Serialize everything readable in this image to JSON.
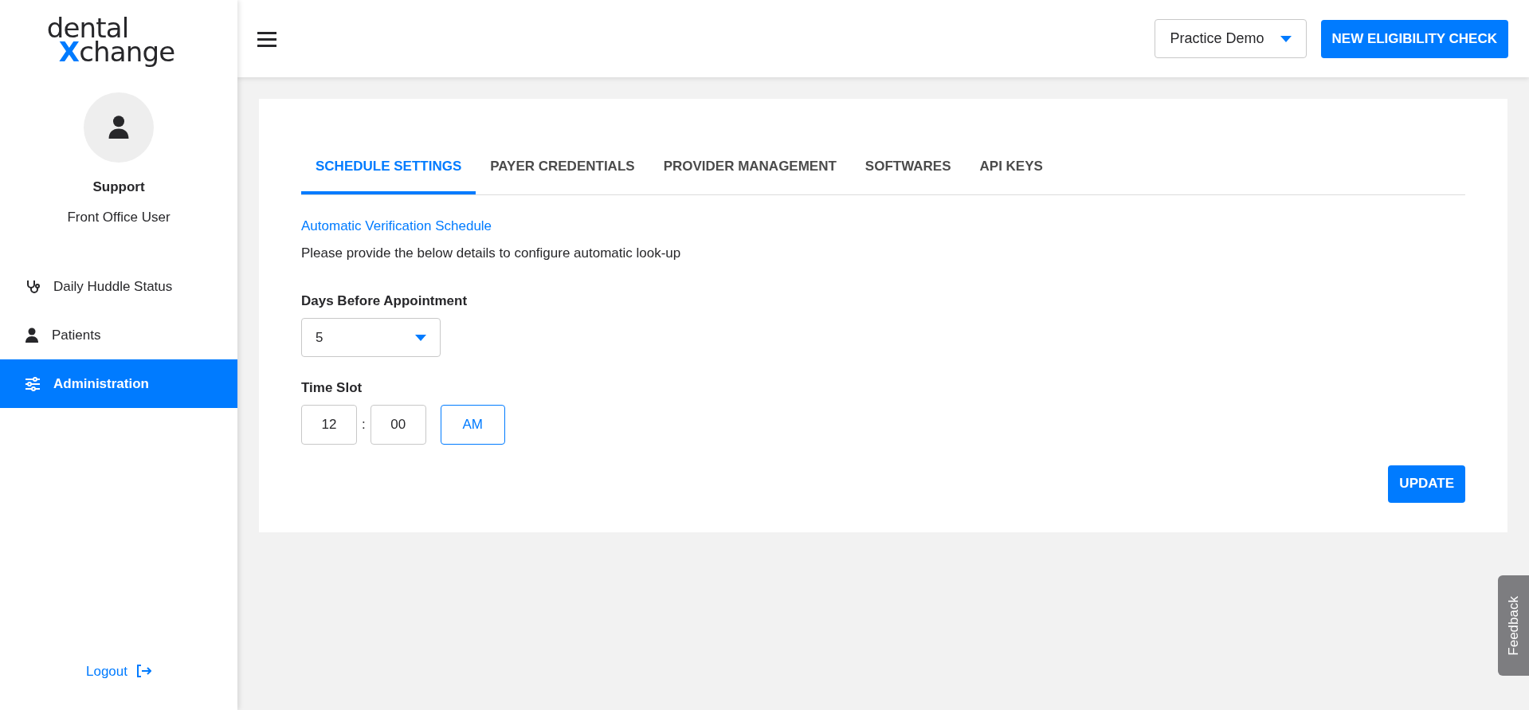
{
  "logo": {
    "line1": "dental",
    "accent": "X",
    "rest": "change"
  },
  "user": {
    "name": "Support",
    "role": "Front Office User"
  },
  "nav": [
    {
      "label": "Daily Huddle Status",
      "kind": "stethoscope",
      "selected": false
    },
    {
      "label": "Patients",
      "kind": "person",
      "selected": false
    },
    {
      "label": "Administration",
      "kind": "sliders",
      "selected": true
    }
  ],
  "logout": "Logout",
  "header": {
    "practice": "Practice Demo",
    "action": "NEW ELIGIBILITY CHECK"
  },
  "tabs": [
    {
      "label": "SCHEDULE SETTINGS",
      "selected": true
    },
    {
      "label": "PAYER CREDENTIALS",
      "selected": false
    },
    {
      "label": "PROVIDER MANAGEMENT",
      "selected": false
    },
    {
      "label": "SOFTWARES",
      "selected": false
    },
    {
      "label": "API KEYS",
      "selected": false
    }
  ],
  "section": {
    "title": "Automatic Verification Schedule",
    "description": "Please provide the below details to configure automatic look-up"
  },
  "days": {
    "label": "Days Before Appointment",
    "value": "5"
  },
  "time": {
    "label": "Time Slot",
    "hour": "12",
    "separator": ":",
    "minute": "00",
    "period": "AM"
  },
  "update": "UPDATE",
  "feedback": "Feedback"
}
